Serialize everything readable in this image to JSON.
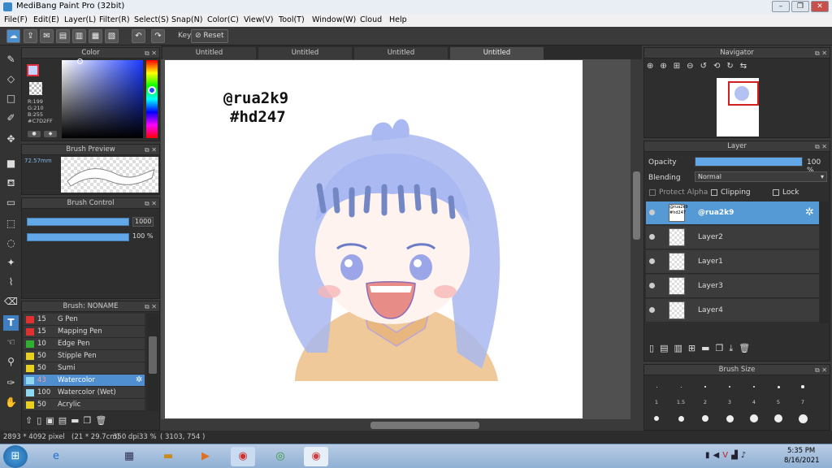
{
  "app": {
    "title": "MediBang Paint Pro (32bit)"
  },
  "menu": [
    "File(F)",
    "Edit(E)",
    "Layer(L)",
    "Filter(R)",
    "Select(S)",
    "Snap(N)",
    "Color(C)",
    "View(V)",
    "Tool(T)",
    "Window(W)",
    "Cloud",
    "Help"
  ],
  "toolbar": {
    "key_label": "Key",
    "reset_label": "Reset"
  },
  "color_panel": {
    "title": "Color",
    "r": "R:199",
    "g": "G:210",
    "b": "B:255",
    "hex": "#C7D2FF",
    "primary": "#C7D2FF"
  },
  "brush_preview": {
    "title": "Brush Preview",
    "size": "72.57mm"
  },
  "brush_control": {
    "title": "Brush Control",
    "size_value": "1000",
    "opacity_value": "100 %"
  },
  "brush_list": {
    "title": "Brush: NONAME",
    "items": [
      {
        "color": "#e03030",
        "num": "15",
        "name": "G Pen"
      },
      {
        "color": "#e03030",
        "num": "15",
        "name": "Mapping Pen"
      },
      {
        "color": "#30b030",
        "num": "10",
        "name": "Edge Pen"
      },
      {
        "color": "#e8d020",
        "num": "50",
        "name": "Stipple Pen"
      },
      {
        "color": "#e8d020",
        "num": "50",
        "name": "Sumi"
      },
      {
        "color": "#8fd8f0",
        "num": "43",
        "name": "Watercolor"
      },
      {
        "color": "#8fd8f0",
        "num": "100",
        "name": "Watercolor (Wet)"
      },
      {
        "color": "#e8d020",
        "num": "50",
        "name": "Acrylic"
      }
    ]
  },
  "tabs": [
    "Untitled",
    "Untitled",
    "Untitled",
    "Untitled"
  ],
  "canvas": {
    "sign1": "@rua2k9",
    "sign2": "#hd247"
  },
  "navigator": {
    "title": "Navigator"
  },
  "layer_panel": {
    "title": "Layer",
    "opacity_label": "Opacity",
    "opacity_value": "100 %",
    "opacity_fraction": 1.0,
    "blending_label": "Blending",
    "blending_value": "Normal",
    "protect_alpha": "Protect Alpha",
    "clipping": "Clipping",
    "lock": "Lock",
    "layers": [
      {
        "name": "@rua2k9",
        "selected": true
      },
      {
        "name": "Layer2"
      },
      {
        "name": "Layer1"
      },
      {
        "name": "Layer3"
      },
      {
        "name": "Layer4"
      }
    ]
  },
  "brush_size": {
    "title": "Brush Size",
    "labels": [
      "1",
      "1.5",
      "2",
      "3",
      "4",
      "5",
      "7"
    ]
  },
  "status": {
    "dims": "2893 * 4092 pixel",
    "paper": "(21 * 29.7cm)",
    "dpi": "350 dpi",
    "zoom": "33 %",
    "coords": "( 3103, 754 )"
  },
  "taskbar": {
    "time": "5:35 PM",
    "date": "8/16/2021"
  }
}
